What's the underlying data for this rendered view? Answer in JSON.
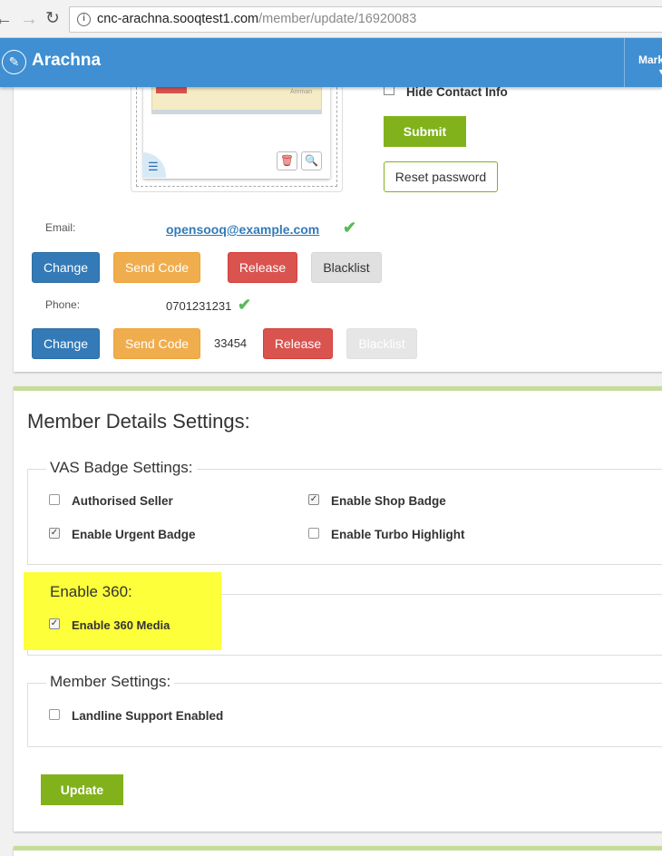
{
  "browser": {
    "url_host": "cnc-arachna.sooqtest1.com",
    "url_path": "/member/update/16920083",
    "icons": {
      "back": "arrow-left-icon",
      "forward": "arrow-right-icon",
      "reload": "reload-icon",
      "info": "info-icon"
    }
  },
  "header": {
    "brand": "Arachna",
    "market_label": "Mark",
    "color": "#3f8fd2"
  },
  "image_preview": {
    "city": "Amman",
    "icons": [
      "menu-icon",
      "trash-icon",
      "zoom-icon"
    ]
  },
  "contact": {
    "hide_label": "Hide Contact Info",
    "submit_label": "Submit",
    "reset_label": "Reset password"
  },
  "email": {
    "label": "Email:",
    "value": "opensooq@example.com",
    "buttons": {
      "change": "Change",
      "send_code": "Send Code",
      "release": "Release",
      "blacklist": "Blacklist"
    }
  },
  "phone": {
    "label": "Phone:",
    "value": "0701231231",
    "code": "33454",
    "buttons": {
      "change": "Change",
      "send_code": "Send Code",
      "release": "Release",
      "blacklist": "Blacklist"
    }
  },
  "details": {
    "title": "Member Details Settings:",
    "vas": {
      "legend": "VAS Badge Settings:",
      "items": [
        {
          "label": "Authorised Seller",
          "checked": false
        },
        {
          "label": "Enable Shop Badge",
          "checked": true
        },
        {
          "label": "Enable Urgent Badge",
          "checked": true
        },
        {
          "label": "Enable Turbo Highlight",
          "checked": false
        }
      ]
    },
    "e360": {
      "legend": "Enable 360:",
      "items": [
        {
          "label": "Enable 360 Media",
          "checked": true
        }
      ]
    },
    "member": {
      "legend": "Member Settings:",
      "items": [
        {
          "label": "Landline Support Enabled",
          "checked": false
        }
      ]
    },
    "update_label": "Update"
  },
  "colors": {
    "green": "#81b21c",
    "highlight": "#fcff3a",
    "primary": "#337ab7",
    "warning": "#f0ad4e",
    "danger": "#d9534f"
  }
}
